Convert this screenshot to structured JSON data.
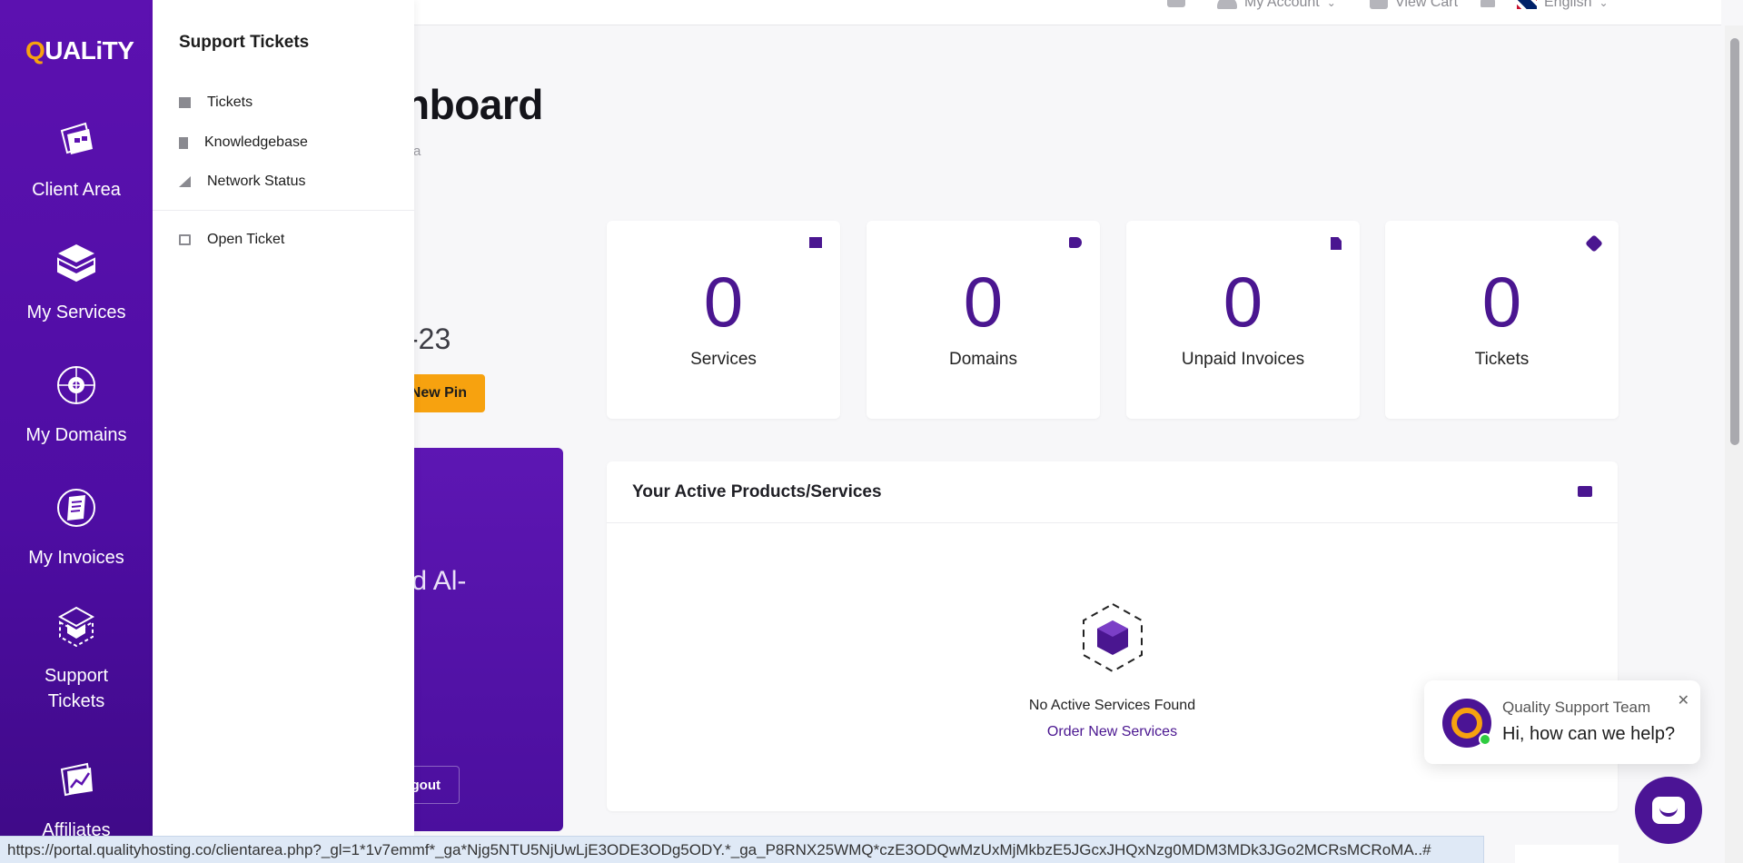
{
  "topbar": {
    "my_account": "My Account",
    "view_cart": "View Cart",
    "language": "English"
  },
  "page": {
    "title": "nboard",
    "subtitle": "a"
  },
  "left_panel": {
    "partial_number": "-23",
    "pin_button": "New Pin",
    "profile_name": "nad Al-",
    "logout_button": "gout"
  },
  "stats": [
    {
      "value": "0",
      "label": "Services",
      "icon": "server-icon"
    },
    {
      "value": "0",
      "label": "Domains",
      "icon": "tag-icon"
    },
    {
      "value": "0",
      "label": "Unpaid Invoices",
      "icon": "document-icon"
    },
    {
      "value": "0",
      "label": "Tickets",
      "icon": "ticket-icon"
    }
  ],
  "products": {
    "title": "Your Active Products/Services",
    "empty_text": "No Active Services Found",
    "order_link": "Order New Services"
  },
  "sidebar": {
    "logo_first": "Q",
    "logo_rest": "UALiTY",
    "items": [
      {
        "label": "Client Area",
        "icon": "client-area-icon"
      },
      {
        "label": "My Services",
        "icon": "services-box-icon"
      },
      {
        "label": "My Domains",
        "icon": "globe-icon"
      },
      {
        "label": "My Invoices",
        "icon": "invoice-icon"
      },
      {
        "label": "Support Tickets",
        "icon": "support-box-icon"
      },
      {
        "label": "Affiliates",
        "icon": "affiliates-chart-icon"
      }
    ]
  },
  "dropdown": {
    "title": "Support Tickets",
    "items": [
      {
        "label": "Tickets",
        "icon": "envelope-icon"
      },
      {
        "label": "Knowledgebase",
        "icon": "book-icon"
      },
      {
        "label": "Network Status",
        "icon": "signal-icon"
      },
      {
        "label": "Open Ticket",
        "icon": "external-link-icon"
      }
    ]
  },
  "chat": {
    "team_name": "Quality Support Team",
    "message": "Hi, how can we help?",
    "close": "✕"
  },
  "statusbar": {
    "url": "https://portal.qualityhosting.co/clientarea.php?_gl=1*1v7emmf*_ga*Njg5NTU5NjUwLjE3ODE3ODg5ODY.*_ga_P8RNX25WMQ*czE3ODQwMzUxMjMkbzE5JGcxJHQxNzg0MDM3MDk3JGo2MCRsMCRoMA..#"
  },
  "colors": {
    "brand_purple": "#4a1690",
    "accent_orange": "#f7a20f"
  }
}
